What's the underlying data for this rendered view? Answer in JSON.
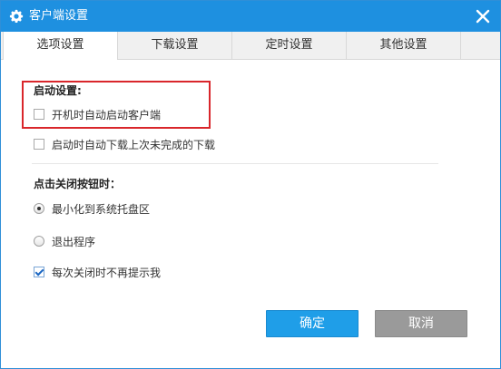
{
  "window": {
    "title": "客户端设置"
  },
  "tabs": [
    {
      "label": "选项设置",
      "active": true
    },
    {
      "label": "下载设置",
      "active": false
    },
    {
      "label": "定时设置",
      "active": false
    },
    {
      "label": "其他设置",
      "active": false
    }
  ],
  "startup": {
    "heading": "启动设置:",
    "auto_start": {
      "label": "开机时自动启动客户端",
      "checked": false
    },
    "auto_resume": {
      "label": "启动时自动下载上次未完成的下载",
      "checked": false
    }
  },
  "close_behavior": {
    "heading": "点击关闭按钮时：",
    "minimize": {
      "label": "最小化到系统托盘区",
      "selected": true
    },
    "exit": {
      "label": "退出程序",
      "selected": false
    },
    "dont_ask": {
      "label": "每次关闭时不再提示我",
      "checked": true
    }
  },
  "buttons": {
    "ok": "确定",
    "cancel": "取消"
  },
  "colors": {
    "titlebar": "#1e90e0",
    "ok_button": "#1f9ee8",
    "cancel_button": "#9a9a9a",
    "highlight": "#d9262b"
  },
  "icons": {
    "title": "gear-icon",
    "close": "close-icon"
  }
}
